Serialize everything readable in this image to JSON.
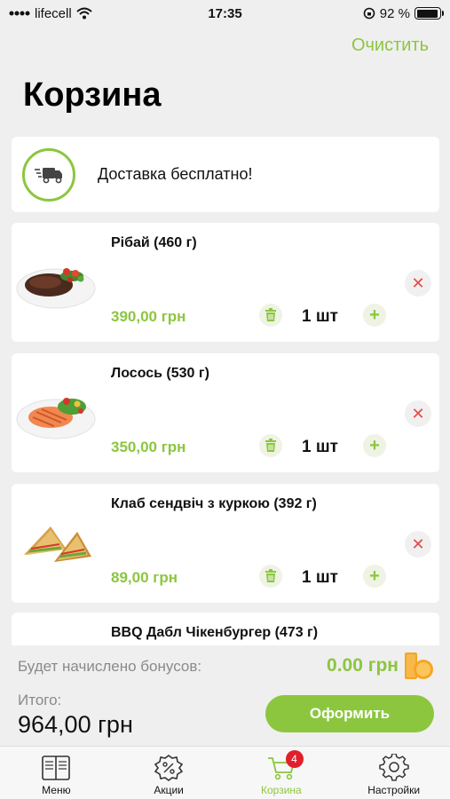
{
  "status_bar": {
    "carrier": "lifecell",
    "time": "17:35",
    "battery": "92 %",
    "battery_level": 0.92
  },
  "header": {
    "clear_label": "Очистить",
    "title": "Корзина"
  },
  "delivery": {
    "text": "Доставка бесплатно!",
    "icon": "truck-icon"
  },
  "items": [
    {
      "name": "Рібай (460 г)",
      "price": "390,00 грн",
      "qty": "1 шт",
      "image": "steak-image"
    },
    {
      "name": "Лосось (530 г)",
      "price": "350,00 грн",
      "qty": "1 шт",
      "image": "salmon-image"
    },
    {
      "name": "Клаб сендвіч з куркою (392 г)",
      "price": "89,00 грн",
      "qty": "1 шт",
      "image": "sandwich-image"
    },
    {
      "name": "BBQ Дабл Чікенбургер (473 г)"
    }
  ],
  "summary": {
    "bonus_label": "Будет начислено бонусов:",
    "bonus_value": "0.00 грн",
    "total_label": "Итого:",
    "total_value": "964,00 грн",
    "checkout_label": "Оформить"
  },
  "tabs": [
    {
      "label": "Меню",
      "icon": "menu-book-icon"
    },
    {
      "label": "Акции",
      "icon": "discount-badge-icon"
    },
    {
      "label": "Корзина",
      "icon": "cart-icon",
      "badge": "4",
      "active": true
    },
    {
      "label": "Настройки",
      "icon": "gear-icon"
    }
  ],
  "colors": {
    "accent": "#8cc63f",
    "remove": "#e34a4a",
    "badge": "#e0202b"
  }
}
